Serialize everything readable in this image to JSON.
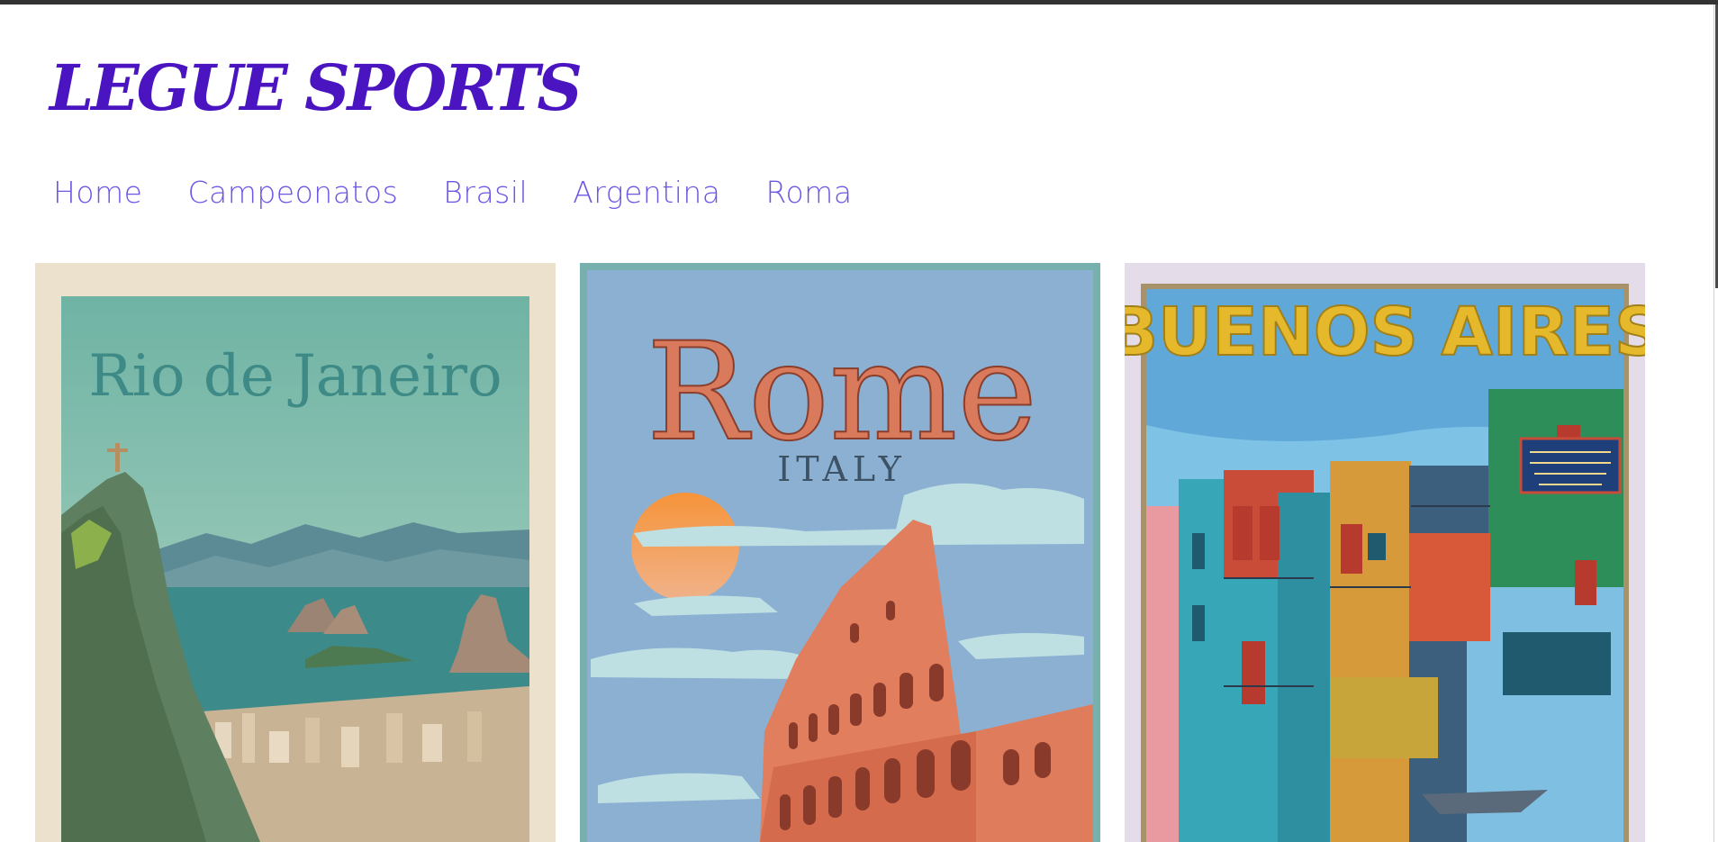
{
  "brand": {
    "logo_text": "LEGUE SPORTS",
    "color": "#4a14c0"
  },
  "nav": {
    "color": "#6e55e3",
    "items": [
      {
        "label": "Home"
      },
      {
        "label": "Campeonatos"
      },
      {
        "label": "Brasil"
      },
      {
        "label": "Argentina"
      },
      {
        "label": "Roma"
      }
    ]
  },
  "posters": [
    {
      "title": "Rio de Janeiro"
    },
    {
      "title": "Rome",
      "subtitle": "ITALY"
    },
    {
      "title": "BUENOS AIRES"
    }
  ]
}
